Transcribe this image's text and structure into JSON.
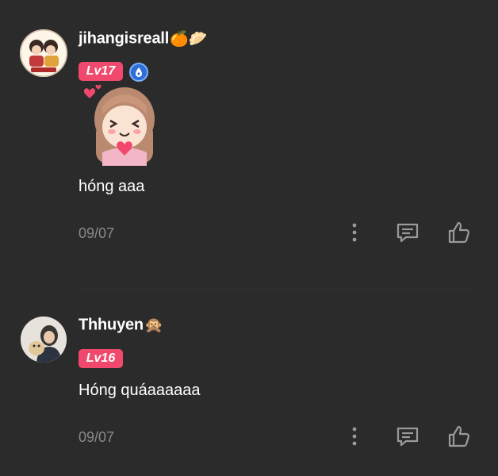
{
  "comments": [
    {
      "username": "jihangisreall",
      "username_emojis": "🍊🥟",
      "level": "Lv17",
      "verified": true,
      "sticker": "anime-girl-heart-sticker",
      "text": "hóng aaa",
      "date": "09/07"
    },
    {
      "username": "Thhuyen",
      "username_emojis": "🙊",
      "level": "Lv16",
      "text": "Hóng quáaaaaaa",
      "date": "09/07"
    }
  ],
  "icons": {
    "more": "more-vertical-icon",
    "reply": "comment-reply-icon",
    "like": "thumbs-up-icon"
  },
  "colors": {
    "background": "#2b2b2b",
    "level_badge": "#f0496d",
    "date_text": "#8a8a8a",
    "icon": "#9a9a9a"
  }
}
